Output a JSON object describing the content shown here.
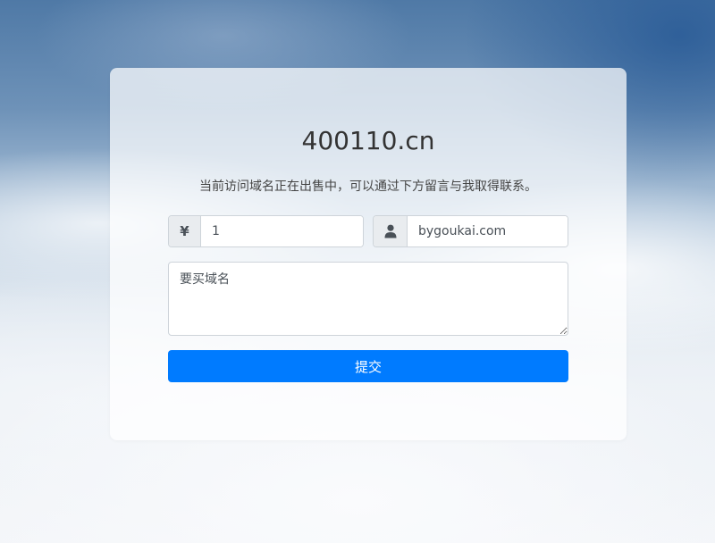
{
  "page": {
    "domain": "400110.cn",
    "subtitle": "当前访问域名正在出售中，可以通过下方留言与我取得联系。"
  },
  "form": {
    "currency_symbol": "¥",
    "price_value": "1",
    "contact_value": "bygoukai.com",
    "message_placeholder": "要买域名",
    "submit_label": "提交"
  },
  "icons": {
    "price": "yen-icon",
    "contact": "user-icon"
  },
  "colors": {
    "primary": "#007bff",
    "addon_bg": "#e9ecef",
    "title": "#333333"
  }
}
